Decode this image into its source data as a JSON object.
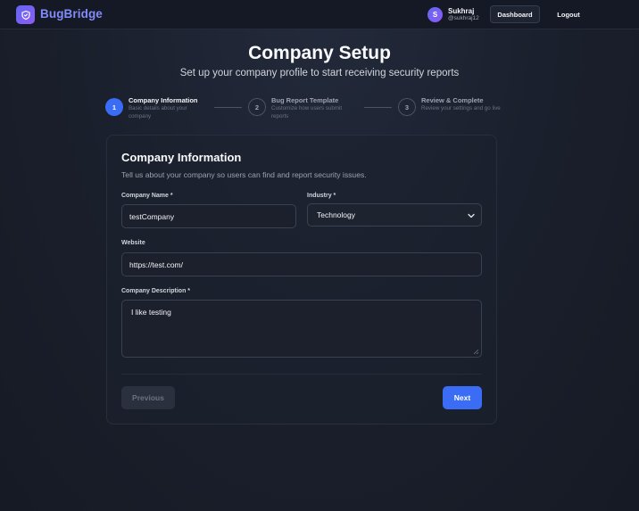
{
  "header": {
    "app_name": "BugBridge",
    "logo_icon": "shield-icon",
    "user": {
      "initial": "S",
      "name": "Sukhraj",
      "handle": "@sukhraj12"
    },
    "dashboard_label": "Dashboard",
    "logout_label": "Logout"
  },
  "page": {
    "title": "Company Setup",
    "subtitle": "Set up your company profile to start receiving security reports"
  },
  "steps": [
    {
      "number": "1",
      "title": "Company Information",
      "description": "Basic details about your company",
      "active": true
    },
    {
      "number": "2",
      "title": "Bug Report Template",
      "description": "Customize how users submit reports",
      "active": false
    },
    {
      "number": "3",
      "title": "Review & Complete",
      "description": "Review your settings and go live",
      "active": false
    }
  ],
  "form": {
    "title": "Company Information",
    "description": "Tell us about your company so users can find and report security issues.",
    "company_name": {
      "label": "Company Name *",
      "value": "testCompany"
    },
    "industry": {
      "label": "Industry *",
      "value": "Technology"
    },
    "website": {
      "label": "Website",
      "value": "https://test.com/"
    },
    "company_description": {
      "label": "Company Description *",
      "value": "I like testing"
    },
    "previous_label": "Previous",
    "next_label": "Next"
  },
  "colors": {
    "accent": "#3b6cf6",
    "brand": "#818cf8",
    "background": "#1a1f2c"
  }
}
